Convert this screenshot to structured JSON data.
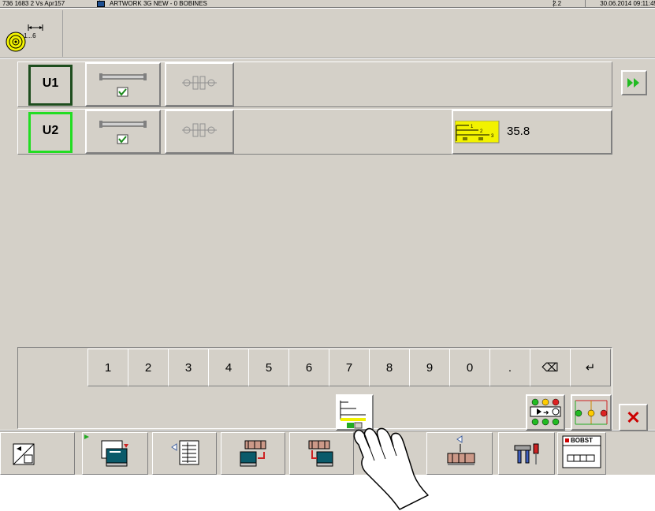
{
  "titlebar": {
    "machine_id": "736 1683 2 Vs Apr157",
    "job_name": "ARTWORK 3G NEW - 0 BOBINES",
    "version": "2.2",
    "datetime": "30.06.2014 09:11:45"
  },
  "header": {
    "reel_icon_label": "1...6"
  },
  "units": [
    {
      "label": "U1",
      "state": "selected-dark"
    },
    {
      "label": "U2",
      "state": "selected-green"
    }
  ],
  "unit2_value": {
    "value": "35.8",
    "diagram_labels": [
      "1",
      "2",
      "3"
    ]
  },
  "keypad": {
    "keys": [
      "1",
      "2",
      "3",
      "4",
      "5",
      "6",
      "7",
      "8",
      "9",
      "0",
      ".",
      "⌫",
      "↵"
    ]
  },
  "actions": {
    "close_symbol": "✕"
  },
  "toolbar": {
    "bobst_label": "BOBST"
  },
  "colors": {
    "panel": "#d4d0c8",
    "u1_border": "#1e4d1e",
    "u2_border": "#22dd22",
    "diagram_yellow": "#f2f200",
    "close_red": "#cc0000",
    "fast_forward_green": "#22bb22"
  }
}
